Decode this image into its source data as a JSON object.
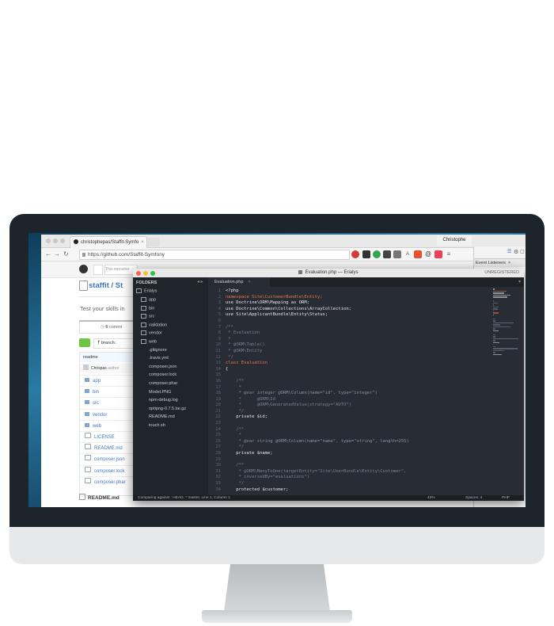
{
  "browser": {
    "tab_title": "christophepas/Staffit-Symfo",
    "profile": "Christophe",
    "url": "https://github.com/Staffit-Symfony"
  },
  "github": {
    "search_placeholder": "This repositor",
    "repo_owner": "staffit",
    "repo_name": "St",
    "description": "Test your skills in",
    "commits_count": "6",
    "commits_label": "commi",
    "branch_prefix": "branch:",
    "file_header": "readme",
    "commit_author": "Chrispas",
    "commit_author_suffix": "author",
    "files": [
      {
        "name": "app",
        "type": "dir"
      },
      {
        "name": "bin",
        "type": "dir"
      },
      {
        "name": "src",
        "type": "dir"
      },
      {
        "name": "vendor",
        "type": "dir"
      },
      {
        "name": "web",
        "type": "dir"
      },
      {
        "name": "LICENSE",
        "type": "file"
      },
      {
        "name": "README.md",
        "type": "file"
      },
      {
        "name": "composer.json",
        "type": "file"
      },
      {
        "name": "composer.lock",
        "type": "file"
      },
      {
        "name": "composer.phar",
        "type": "file"
      }
    ],
    "readme_title": "README.md"
  },
  "devtools": {
    "tab_label": "Event Listeners",
    "links": [
      "ymfony",
      ".css:1",
      "ymfony",
      ".css:1",
      "ymfony",
      ".css:1",
      "sheet",
      "ymfony",
      ".css:1",
      "ymfony",
      ".css:1",
      "ymfony",
      ".css:1",
      "ymfony",
      ".css:1"
    ]
  },
  "sublime": {
    "window_title": "Evaluation.php — Erialys",
    "unregistered": "UNREGISTERED",
    "folders_title": "FOLDERS",
    "root_folder": "Erialys",
    "tree": [
      {
        "name": "app",
        "kind": "folder"
      },
      {
        "name": "bin",
        "kind": "folder"
      },
      {
        "name": "src",
        "kind": "folder"
      },
      {
        "name": "validation",
        "kind": "folder"
      },
      {
        "name": "vendor",
        "kind": "folder"
      },
      {
        "name": "web",
        "kind": "folder"
      },
      {
        "name": ".gitignore",
        "kind": "file"
      },
      {
        "name": ".travis.yml",
        "kind": "file"
      },
      {
        "name": "composer.json",
        "kind": "file"
      },
      {
        "name": "composer.lock",
        "kind": "file"
      },
      {
        "name": "composer.phar",
        "kind": "file"
      },
      {
        "name": "Model.PNG",
        "kind": "file"
      },
      {
        "name": "npm-debug.log",
        "kind": "file"
      },
      {
        "name": "optipng-0.7.5.tar.gz",
        "kind": "file"
      },
      {
        "name": "README.md",
        "kind": "file"
      },
      {
        "name": "touch.sh",
        "kind": "file"
      }
    ],
    "tab_label": "Evaluation.php",
    "line_numbers": [
      "1",
      "2",
      "3",
      "4",
      "5",
      "6",
      "7",
      "8",
      "9",
      "10",
      "11",
      "12",
      "13",
      "14",
      "15",
      "16",
      "17",
      "18",
      "19",
      "20",
      "21",
      "22",
      "23",
      "24",
      "25",
      "26",
      "27",
      "28",
      "29",
      "30",
      "31",
      "32",
      "33",
      "34"
    ],
    "code": [
      {
        "text": "<?php",
        "color": "#e6e6e6"
      },
      {
        "text": "namespace Site\\CustomerBundle\\Entity;",
        "color": "#e8794a"
      },
      {
        "text": "use Doctrine\\ORM\\Mapping as ORM;",
        "color": "#e6e6e6"
      },
      {
        "text": "use Doctrine\\Common\\Collections\\ArrayCollection;",
        "color": "#e6e6e6"
      },
      {
        "text": "use Site\\ApplicantBundle\\Entity\\Status;",
        "color": "#e6e6e6"
      },
      {
        "text": "",
        "color": "#e6e6e6"
      },
      {
        "text": "/**",
        "color": "#7a828c"
      },
      {
        "text": " * Evaluation",
        "color": "#7a828c"
      },
      {
        "text": " *",
        "color": "#7a828c"
      },
      {
        "text": " * @ORM\\Table()",
        "color": "#7a828c"
      },
      {
        "text": " * @ORM\\Entity",
        "color": "#7a828c"
      },
      {
        "text": " */",
        "color": "#7a828c"
      },
      {
        "text": "class Evaluation",
        "color": "#e8794a"
      },
      {
        "text": "{",
        "color": "#e6e6e6"
      },
      {
        "text": "",
        "color": "#e6e6e6"
      },
      {
        "text": "    /**",
        "color": "#7a828c"
      },
      {
        "text": "     *",
        "color": "#7a828c"
      },
      {
        "text": "     * @var integer @ORM\\Column(name=\"id\", type=\"integer\")",
        "color": "#8a929c"
      },
      {
        "text": "     *      @ORM\\Id",
        "color": "#7a828c"
      },
      {
        "text": "     *      @ORM\\GeneratedValue(strategy=\"AUTO\")",
        "color": "#7a828c"
      },
      {
        "text": "     */",
        "color": "#7a828c"
      },
      {
        "text": "    private $id;",
        "color": "#e6e6e6"
      },
      {
        "text": "",
        "color": "#e6e6e6"
      },
      {
        "text": "    /**",
        "color": "#7a828c"
      },
      {
        "text": "     *",
        "color": "#7a828c"
      },
      {
        "text": "     * @var string @ORM\\Column(name=\"name\", type=\"string\", length=255)",
        "color": "#8a929c"
      },
      {
        "text": "     */",
        "color": "#7a828c"
      },
      {
        "text": "    private $name;",
        "color": "#e6e6e6"
      },
      {
        "text": "",
        "color": "#e6e6e6"
      },
      {
        "text": "    /**",
        "color": "#7a828c"
      },
      {
        "text": "     * @ORM\\ManyToOne(targetEntity=\"Site\\UserBundle\\Entity\\Customer\",",
        "color": "#7a828c"
      },
      {
        "text": "     * inversedBy=\"evaluations\")",
        "color": "#7a828c"
      },
      {
        "text": "     */",
        "color": "#7a828c"
      },
      {
        "text": "    protected $customer;",
        "color": "#e6e6e6"
      }
    ],
    "status_left": "Comparing against : HEAD, * master, Line 1, Column 1",
    "status_percent": "43%",
    "status_spaces": "Spaces: 4",
    "status_syntax": "PHP"
  }
}
